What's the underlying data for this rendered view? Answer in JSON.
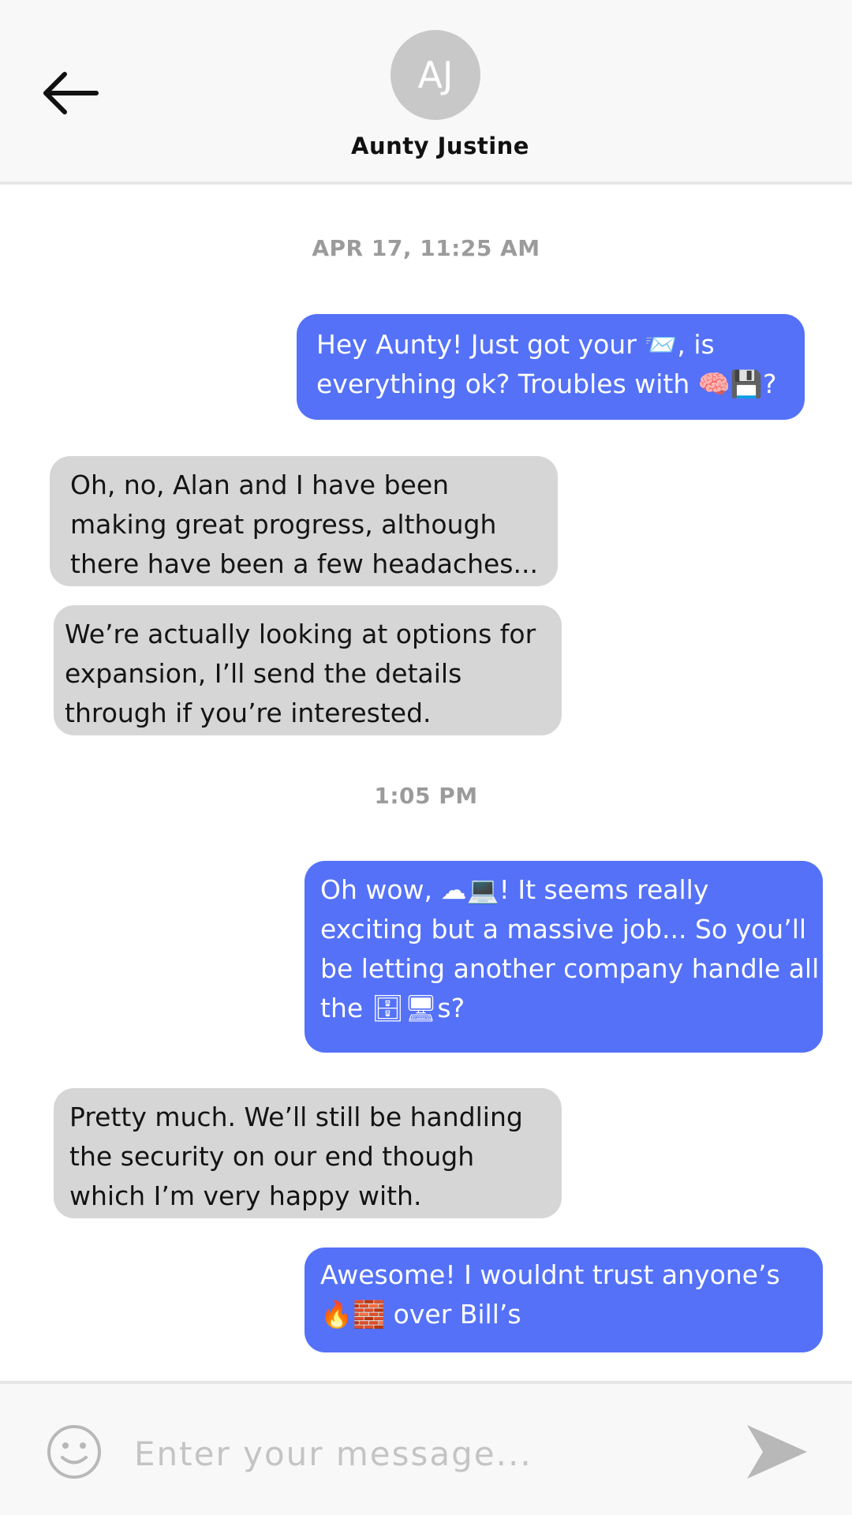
{
  "header": {
    "avatar_initials": "AJ",
    "contact_name": "Aunty Justine"
  },
  "timestamps": [
    "APR 17, 11:25 AM",
    "1:05 PM"
  ],
  "messages": [
    {
      "direction": "outgoing",
      "lines": [
        "Hey Aunty! Just got your 📨, is",
        "everything ok? Troubles with 🧠💾?"
      ]
    },
    {
      "direction": "incoming",
      "lines": [
        "Oh, no, Alan and I have been",
        "making great progress, although",
        "there have been a few headaches..."
      ]
    },
    {
      "direction": "incoming",
      "lines": [
        "We’re actually looking at options for",
        "expansion, I’ll send the details",
        "through if you’re interested."
      ]
    },
    {
      "direction": "outgoing",
      "lines": [
        "Oh wow, ☁💻! It seems really",
        "exciting but a massive job... So you’ll",
        "be letting another company handle all",
        "the 🗄🖥s?"
      ]
    },
    {
      "direction": "incoming",
      "lines": [
        "Pretty much. We’ll still be handling",
        "the security on our end though",
        "which I’m very happy with."
      ]
    },
    {
      "direction": "outgoing",
      "lines": [
        "Awesome! I wouldnt trust anyone’s",
        "🔥🧱 over Bill’s"
      ]
    }
  ],
  "composer": {
    "placeholder": "Enter your message..."
  },
  "colors": {
    "outgoing_bubble": "#5471f8",
    "incoming_bubble": "#d6d6d6",
    "header_bg": "#f8f8f8",
    "timestamp": "#9b9b9b"
  },
  "icons": {
    "back": "arrow-left-icon",
    "emoji": "smiley-icon",
    "send": "send-arrow-icon"
  }
}
